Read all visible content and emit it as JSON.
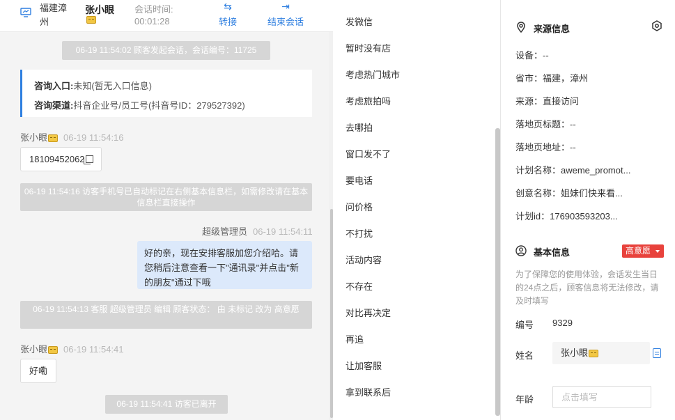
{
  "header": {
    "location": "福建漳州",
    "visitor_name": "张小眼",
    "session_time_label": "会话时间:",
    "session_time_value": "00:01:28",
    "transfer_label": "转接",
    "end_session_label": "结束会话"
  },
  "chat": {
    "sys_start": "06-19 11:54:02 顾客发起会话，会话编号：11725",
    "entry_label": "咨询入口:",
    "entry_value": "未知(暂无入口信息)",
    "channel_label": "咨询渠道:",
    "channel_value": "抖音企业号/员工号(抖音号ID：279527392)",
    "visitor_msg1_name": "张小眼",
    "visitor_msg1_time": "06-19 11:54:16",
    "visitor_msg1_text": "18109452062",
    "sys_phone": "06-19 11:54:16 访客手机号已自动标记在右侧基本信息栏，如需修改请在基本信息栏直接操作",
    "agent_name": "超级管理员",
    "agent_time": "06-19 11:54:11",
    "agent_text": "好的亲，现在安排客服加您介绍哈。请您稍后注意查看一下\"通讯录\"并点击\"新的朋友\"通过下哦",
    "sys_status": "06-19 11:54:13 客服 超级管理员 编辑 顾客状态： 由 未标记 改为 高意愿",
    "visitor_msg2_name": "张小眼",
    "visitor_msg2_time": "06-19 11:54:41",
    "visitor_msg2_text": "好嘞",
    "sys_left": "06-19 11:54:41 访客已离开"
  },
  "quick_replies": [
    "发微信",
    "暂时没有店",
    "考虑热门城市",
    "考虑旅拍吗",
    "去哪拍",
    "窗口发不了",
    "要电话",
    "问价格",
    "不打扰",
    "活动内容",
    "不存在",
    "对比再决定",
    "再追",
    "让加客服",
    "拿到联系后"
  ],
  "source_info": {
    "title": "来源信息",
    "device": "设备：--",
    "province_city": "省市：福建，漳州",
    "source": "来源：直接访问",
    "landing_title": "落地页标题：--",
    "landing_url": "落地页地址：--",
    "plan_name": "计划名称：aweme_promot...",
    "creative_name": "创意名称：姐妹们快来看...",
    "plan_id": "计划id：176903593203..."
  },
  "basic_info": {
    "title": "基本信息",
    "intent_tag": "高意愿",
    "note": "为了保障您的使用体验，会话发生当日的24点之后，顾客信息将无法修改，请及时填写",
    "id_label": "编号",
    "id_value": "9329",
    "name_label": "姓名",
    "name_value": "张小眼",
    "age_label": "年龄",
    "age_placeholder": "点击填写"
  },
  "colors": {
    "accent": "#2f7fe0",
    "agent_bubble": "#dce9fb",
    "system_pill": "#d6d6d6",
    "intent_tag": "#e8423c"
  }
}
